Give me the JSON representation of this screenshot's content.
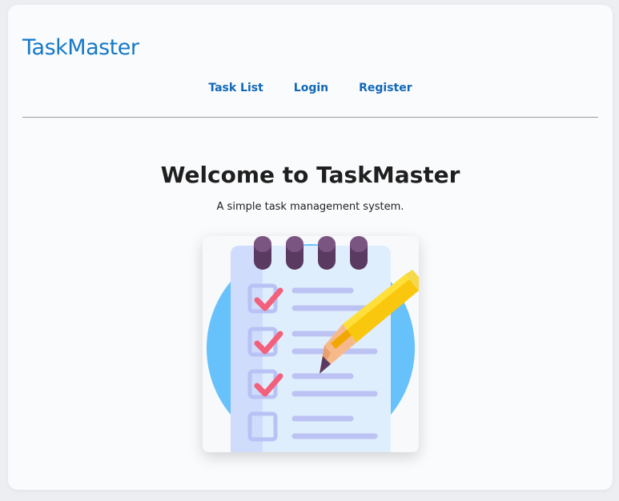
{
  "header": {
    "brand": "TaskMaster"
  },
  "nav": {
    "items": [
      {
        "label": "Task List"
      },
      {
        "label": "Login"
      },
      {
        "label": "Register"
      }
    ]
  },
  "main": {
    "title": "Welcome to TaskMaster",
    "subtitle": "A simple task management system."
  },
  "colors": {
    "brand": "#1679c7",
    "nav_link": "#1168b6",
    "circle": "#67c1fb",
    "checkmark": "#f2607c",
    "pencil": "#f9c80e",
    "binding": "#5b3a62"
  },
  "icons": {
    "hero": "notepad-checklist-pencil-illustration"
  }
}
